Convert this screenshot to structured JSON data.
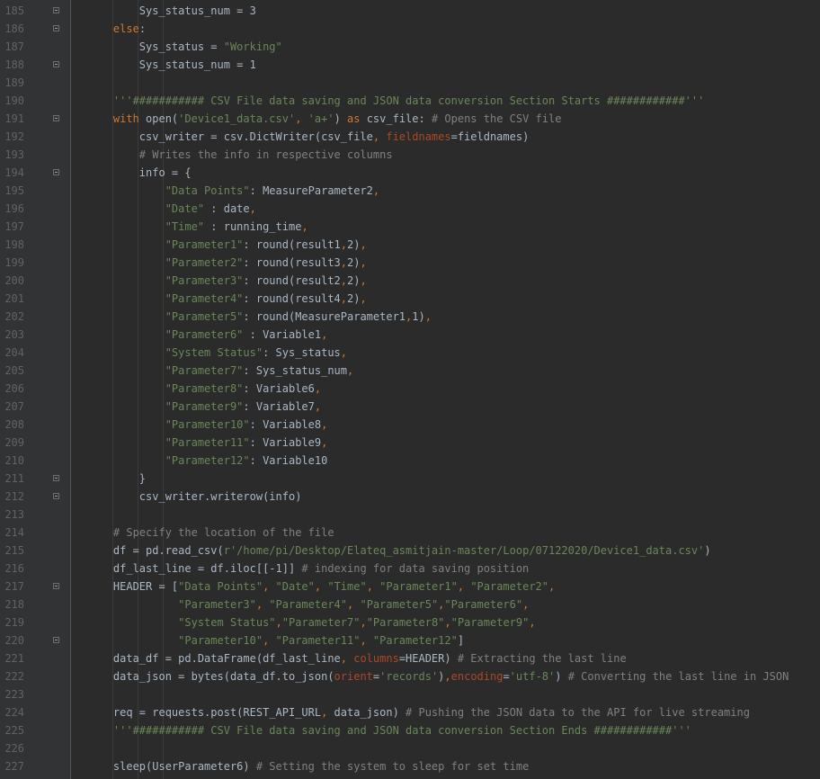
{
  "colors": {
    "background": "#2b2b2b",
    "gutter": "#313335",
    "line_number": "#606366",
    "text": "#a9b7c6",
    "keyword": "#cc7832",
    "string": "#6a8759",
    "comment": "#808080",
    "named_param": "#aa4926"
  },
  "icons": {
    "fold": "fold-marker-icon"
  },
  "lines": [
    {
      "n": "185",
      "fold": true,
      "indent": "        ",
      "tokens": [
        {
          "t": "Sys_status_num = 3",
          "c": "t"
        }
      ]
    },
    {
      "n": "186",
      "fold": true,
      "indent": "    ",
      "tokens": [
        {
          "t": "else",
          "c": "kw"
        },
        {
          "t": ":",
          "c": "t"
        }
      ]
    },
    {
      "n": "187",
      "fold": false,
      "indent": "        ",
      "tokens": [
        {
          "t": "Sys_status = ",
          "c": "t"
        },
        {
          "t": "\"Working\"",
          "c": "str"
        }
      ]
    },
    {
      "n": "188",
      "fold": true,
      "indent": "        ",
      "tokens": [
        {
          "t": "Sys_status_num = 1",
          "c": "t"
        }
      ]
    },
    {
      "n": "189",
      "fold": false,
      "indent": "",
      "tokens": []
    },
    {
      "n": "190",
      "fold": false,
      "indent": "    ",
      "tokens": [
        {
          "t": "'''########### CSV File data saving and JSON data conversion Section Starts ############'''",
          "c": "str"
        }
      ]
    },
    {
      "n": "191",
      "fold": true,
      "indent": "    ",
      "tokens": [
        {
          "t": "with ",
          "c": "kw"
        },
        {
          "t": "open(",
          "c": "t"
        },
        {
          "t": "'Device1_data.csv'",
          "c": "str"
        },
        {
          "t": ", ",
          "c": "kw"
        },
        {
          "t": "'a+'",
          "c": "str"
        },
        {
          "t": ") ",
          "c": "t"
        },
        {
          "t": "as ",
          "c": "kw"
        },
        {
          "t": "csv_file: ",
          "c": "t"
        },
        {
          "t": "# Opens the CSV file",
          "c": "cm"
        }
      ]
    },
    {
      "n": "192",
      "fold": false,
      "indent": "        ",
      "tokens": [
        {
          "t": "csv_writer = csv.DictWriter(csv_file",
          "c": "t"
        },
        {
          "t": ", ",
          "c": "kw"
        },
        {
          "t": "fieldnames",
          "c": "param"
        },
        {
          "t": "=fieldnames)",
          "c": "t"
        }
      ]
    },
    {
      "n": "193",
      "fold": false,
      "indent": "        ",
      "tokens": [
        {
          "t": "# Writes the info in respective columns",
          "c": "cm"
        }
      ]
    },
    {
      "n": "194",
      "fold": true,
      "indent": "        ",
      "tokens": [
        {
          "t": "info = {",
          "c": "t"
        }
      ]
    },
    {
      "n": "195",
      "fold": false,
      "indent": "            ",
      "tokens": [
        {
          "t": "\"Data Points\"",
          "c": "str"
        },
        {
          "t": ": MeasureParameter2",
          "c": "t"
        },
        {
          "t": ",",
          "c": "kw"
        }
      ]
    },
    {
      "n": "196",
      "fold": false,
      "indent": "            ",
      "tokens": [
        {
          "t": "\"Date\"",
          "c": "str"
        },
        {
          "t": " : date",
          "c": "t"
        },
        {
          "t": ",",
          "c": "kw"
        }
      ]
    },
    {
      "n": "197",
      "fold": false,
      "indent": "            ",
      "tokens": [
        {
          "t": "\"Time\"",
          "c": "str"
        },
        {
          "t": " : running_time",
          "c": "t"
        },
        {
          "t": ",",
          "c": "kw"
        }
      ]
    },
    {
      "n": "198",
      "fold": false,
      "indent": "            ",
      "tokens": [
        {
          "t": "\"Parameter1\"",
          "c": "str"
        },
        {
          "t": ": round(result1",
          "c": "t"
        },
        {
          "t": ",",
          "c": "kw"
        },
        {
          "t": "2)",
          "c": "t"
        },
        {
          "t": ",",
          "c": "kw"
        }
      ]
    },
    {
      "n": "199",
      "fold": false,
      "indent": "            ",
      "tokens": [
        {
          "t": "\"Parameter2\"",
          "c": "str"
        },
        {
          "t": ": round(result3",
          "c": "t"
        },
        {
          "t": ",",
          "c": "kw"
        },
        {
          "t": "2)",
          "c": "t"
        },
        {
          "t": ",",
          "c": "kw"
        }
      ]
    },
    {
      "n": "200",
      "fold": false,
      "indent": "            ",
      "tokens": [
        {
          "t": "\"Parameter3\"",
          "c": "str"
        },
        {
          "t": ": round(result2",
          "c": "t"
        },
        {
          "t": ",",
          "c": "kw"
        },
        {
          "t": "2)",
          "c": "t"
        },
        {
          "t": ",",
          "c": "kw"
        }
      ]
    },
    {
      "n": "201",
      "fold": false,
      "indent": "            ",
      "tokens": [
        {
          "t": "\"Parameter4\"",
          "c": "str"
        },
        {
          "t": ": round(result4",
          "c": "t"
        },
        {
          "t": ",",
          "c": "kw"
        },
        {
          "t": "2)",
          "c": "t"
        },
        {
          "t": ",",
          "c": "kw"
        }
      ]
    },
    {
      "n": "202",
      "fold": false,
      "indent": "            ",
      "tokens": [
        {
          "t": "\"Parameter5\"",
          "c": "str"
        },
        {
          "t": ": round(MeasureParameter1",
          "c": "t"
        },
        {
          "t": ",",
          "c": "kw"
        },
        {
          "t": "1)",
          "c": "t"
        },
        {
          "t": ",",
          "c": "kw"
        }
      ]
    },
    {
      "n": "203",
      "fold": false,
      "indent": "            ",
      "tokens": [
        {
          "t": "\"Parameter6\"",
          "c": "str"
        },
        {
          "t": " : Variable1",
          "c": "t"
        },
        {
          "t": ",",
          "c": "kw"
        }
      ]
    },
    {
      "n": "204",
      "fold": false,
      "indent": "            ",
      "tokens": [
        {
          "t": "\"System Status\"",
          "c": "str"
        },
        {
          "t": ": Sys_status",
          "c": "t"
        },
        {
          "t": ",",
          "c": "kw"
        }
      ]
    },
    {
      "n": "205",
      "fold": false,
      "indent": "            ",
      "tokens": [
        {
          "t": "\"Parameter7\"",
          "c": "str"
        },
        {
          "t": ": Sys_status_num",
          "c": "t"
        },
        {
          "t": ",",
          "c": "kw"
        }
      ]
    },
    {
      "n": "206",
      "fold": false,
      "indent": "            ",
      "tokens": [
        {
          "t": "\"Parameter8\"",
          "c": "str"
        },
        {
          "t": ": Variable6",
          "c": "t"
        },
        {
          "t": ",",
          "c": "kw"
        }
      ]
    },
    {
      "n": "207",
      "fold": false,
      "indent": "            ",
      "tokens": [
        {
          "t": "\"Parameter9\"",
          "c": "str"
        },
        {
          "t": ": Variable7",
          "c": "t"
        },
        {
          "t": ",",
          "c": "kw"
        }
      ]
    },
    {
      "n": "208",
      "fold": false,
      "indent": "            ",
      "tokens": [
        {
          "t": "\"Parameter10\"",
          "c": "str"
        },
        {
          "t": ": Variable8",
          "c": "t"
        },
        {
          "t": ",",
          "c": "kw"
        }
      ]
    },
    {
      "n": "209",
      "fold": false,
      "indent": "            ",
      "tokens": [
        {
          "t": "\"Parameter11\"",
          "c": "str"
        },
        {
          "t": ": Variable9",
          "c": "t"
        },
        {
          "t": ",",
          "c": "kw"
        }
      ]
    },
    {
      "n": "210",
      "fold": false,
      "indent": "            ",
      "tokens": [
        {
          "t": "\"Parameter12\"",
          "c": "str"
        },
        {
          "t": ": Variable10",
          "c": "t"
        }
      ]
    },
    {
      "n": "211",
      "fold": true,
      "indent": "        ",
      "tokens": [
        {
          "t": "}",
          "c": "t"
        }
      ]
    },
    {
      "n": "212",
      "fold": true,
      "indent": "        ",
      "tokens": [
        {
          "t": "csv_writer.writerow(info)",
          "c": "t"
        }
      ]
    },
    {
      "n": "213",
      "fold": false,
      "indent": "",
      "tokens": []
    },
    {
      "n": "214",
      "fold": false,
      "indent": "    ",
      "tokens": [
        {
          "t": "# Specify the location of the file",
          "c": "cm"
        }
      ]
    },
    {
      "n": "215",
      "fold": false,
      "indent": "    ",
      "tokens": [
        {
          "t": "df = pd.read_csv(",
          "c": "t"
        },
        {
          "t": "r'/home/pi/Desktop/Elateq_asmitjain-master/Loop/07122020/Device1_data.csv'",
          "c": "str"
        },
        {
          "t": ")",
          "c": "t"
        }
      ]
    },
    {
      "n": "216",
      "fold": false,
      "indent": "    ",
      "tokens": [
        {
          "t": "df_last_line = df.iloc[[-1]] ",
          "c": "t"
        },
        {
          "t": "# indexing for data saving position",
          "c": "cm"
        }
      ]
    },
    {
      "n": "217",
      "fold": true,
      "indent": "    ",
      "tokens": [
        {
          "t": "HEADER = [",
          "c": "t"
        },
        {
          "t": "\"Data Points\"",
          "c": "str"
        },
        {
          "t": ", ",
          "c": "kw"
        },
        {
          "t": "\"Date\"",
          "c": "str"
        },
        {
          "t": ", ",
          "c": "kw"
        },
        {
          "t": "\"Time\"",
          "c": "str"
        },
        {
          "t": ", ",
          "c": "kw"
        },
        {
          "t": "\"Parameter1\"",
          "c": "str"
        },
        {
          "t": ", ",
          "c": "kw"
        },
        {
          "t": "\"Parameter2\"",
          "c": "str"
        },
        {
          "t": ",",
          "c": "kw"
        }
      ]
    },
    {
      "n": "218",
      "fold": false,
      "indent": "              ",
      "tokens": [
        {
          "t": "\"Parameter3\"",
          "c": "str"
        },
        {
          "t": ", ",
          "c": "kw"
        },
        {
          "t": "\"Parameter4\"",
          "c": "str"
        },
        {
          "t": ", ",
          "c": "kw"
        },
        {
          "t": "\"Parameter5\"",
          "c": "str"
        },
        {
          "t": ",",
          "c": "kw"
        },
        {
          "t": "\"Parameter6\"",
          "c": "str"
        },
        {
          "t": ",",
          "c": "kw"
        }
      ]
    },
    {
      "n": "219",
      "fold": false,
      "indent": "              ",
      "tokens": [
        {
          "t": "\"System Status\"",
          "c": "str"
        },
        {
          "t": ",",
          "c": "kw"
        },
        {
          "t": "\"Parameter7\"",
          "c": "str"
        },
        {
          "t": ",",
          "c": "kw"
        },
        {
          "t": "\"Parameter8\"",
          "c": "str"
        },
        {
          "t": ",",
          "c": "kw"
        },
        {
          "t": "\"Parameter9\"",
          "c": "str"
        },
        {
          "t": ",",
          "c": "kw"
        }
      ]
    },
    {
      "n": "220",
      "fold": true,
      "indent": "              ",
      "tokens": [
        {
          "t": "\"Parameter10\"",
          "c": "str"
        },
        {
          "t": ", ",
          "c": "kw"
        },
        {
          "t": "\"Parameter11\"",
          "c": "str"
        },
        {
          "t": ", ",
          "c": "kw"
        },
        {
          "t": "\"Parameter12\"",
          "c": "str"
        },
        {
          "t": "]",
          "c": "t"
        }
      ]
    },
    {
      "n": "221",
      "fold": false,
      "indent": "    ",
      "tokens": [
        {
          "t": "data_df = pd.DataFrame(df_last_line",
          "c": "t"
        },
        {
          "t": ", ",
          "c": "kw"
        },
        {
          "t": "columns",
          "c": "param"
        },
        {
          "t": "=HEADER) ",
          "c": "t"
        },
        {
          "t": "# Extracting the last line",
          "c": "cm"
        }
      ]
    },
    {
      "n": "222",
      "fold": false,
      "indent": "    ",
      "tokens": [
        {
          "t": "data_json = bytes(data_df.to_json(",
          "c": "t"
        },
        {
          "t": "orient",
          "c": "param"
        },
        {
          "t": "=",
          "c": "t"
        },
        {
          "t": "'records'",
          "c": "str"
        },
        {
          "t": ")",
          "c": "t"
        },
        {
          "t": ",",
          "c": "kw"
        },
        {
          "t": "encoding",
          "c": "param"
        },
        {
          "t": "=",
          "c": "t"
        },
        {
          "t": "'utf-8'",
          "c": "str"
        },
        {
          "t": ") ",
          "c": "t"
        },
        {
          "t": "# Converting the last line in JSON",
          "c": "cm"
        }
      ]
    },
    {
      "n": "223",
      "fold": false,
      "indent": "",
      "tokens": []
    },
    {
      "n": "224",
      "fold": false,
      "indent": "    ",
      "tokens": [
        {
          "t": "req = requests.post(REST_API_URL",
          "c": "t"
        },
        {
          "t": ", ",
          "c": "kw"
        },
        {
          "t": "data_json) ",
          "c": "t"
        },
        {
          "t": "# Pushing the JSON data to the API for live streaming",
          "c": "cm"
        }
      ]
    },
    {
      "n": "225",
      "fold": false,
      "indent": "    ",
      "tokens": [
        {
          "t": "'''########### CSV File data saving and JSON data conversion Section Ends ############'''",
          "c": "str"
        }
      ]
    },
    {
      "n": "226",
      "fold": false,
      "indent": "",
      "tokens": []
    },
    {
      "n": "227",
      "fold": false,
      "indent": "    ",
      "tokens": [
        {
          "t": "sleep(UserParameter6) ",
          "c": "t"
        },
        {
          "t": "# Setting the system to sleep for set time",
          "c": "cm"
        }
      ]
    }
  ]
}
